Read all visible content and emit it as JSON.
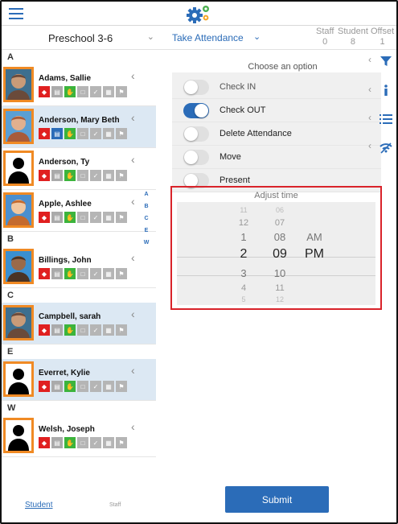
{
  "header": {
    "menu_icon": "hamburger-icon",
    "logo_icon": "gears-logo-icon"
  },
  "subheader": {
    "class_name": "Preschool 3-6",
    "action": "Take Attendance",
    "counts": [
      {
        "label": "Staff",
        "value": "0"
      },
      {
        "label": "Student",
        "value": "8"
      },
      {
        "label": "Offset",
        "value": "1"
      }
    ]
  },
  "sections": [
    {
      "letter": "A",
      "students": [
        {
          "name": "Adams, Sallie",
          "photo": "child-photo",
          "selected": false,
          "doc_blue": false
        },
        {
          "name": "Anderson, Mary Beth",
          "photo": "child-photo",
          "selected": true,
          "doc_blue": true
        },
        {
          "name": "Anderson, Ty",
          "photo": "silhouette",
          "selected": false,
          "doc_blue": false
        },
        {
          "name": "Apple, Ashlee",
          "photo": "child-photo",
          "selected": false,
          "doc_blue": false
        }
      ]
    },
    {
      "letter": "B",
      "students": [
        {
          "name": "Billings, John",
          "photo": "child-photo",
          "selected": false,
          "doc_blue": false
        }
      ]
    },
    {
      "letter": "C",
      "students": [
        {
          "name": "Campbell, sarah",
          "photo": "child-photo",
          "selected": true,
          "doc_blue": false
        }
      ]
    },
    {
      "letter": "E",
      "students": [
        {
          "name": "Everret, Kylie",
          "photo": "silhouette",
          "selected": true,
          "doc_blue": false
        }
      ]
    },
    {
      "letter": "W",
      "students": [
        {
          "name": "Welsh, Joseph",
          "photo": "silhouette",
          "selected": false,
          "doc_blue": false
        }
      ]
    }
  ],
  "alpha_index": [
    "A",
    "B",
    "C",
    "E",
    "W"
  ],
  "panel": {
    "prompt": "Choose an option",
    "options": [
      {
        "label": "Check IN",
        "on": false
      },
      {
        "label": "Check OUT",
        "on": true
      },
      {
        "label": "Delete Attendance",
        "on": false
      },
      {
        "label": "Move",
        "on": false
      },
      {
        "label": "Present",
        "on": false
      }
    ],
    "time_title": "Adjust time",
    "hours": [
      "11",
      "12",
      "1",
      "2",
      "3",
      "4",
      "5"
    ],
    "minutes": [
      "06",
      "07",
      "08",
      "09",
      "10",
      "11",
      "12"
    ],
    "ampm": [
      "AM",
      "PM"
    ],
    "selected": {
      "hour": "2",
      "minute": "09",
      "ampm": "PM"
    }
  },
  "side_icons": [
    "filter-icon",
    "info-icon",
    "list-icon",
    "wifi-icon"
  ],
  "footer": {
    "student_tab": "Student",
    "staff_tab": "Staff",
    "submit": "Submit"
  },
  "colors": {
    "accent": "#2b6cb8",
    "highlight": "#d9232a",
    "photo_border": "#f08a24",
    "selected_row": "#dce8f3"
  }
}
